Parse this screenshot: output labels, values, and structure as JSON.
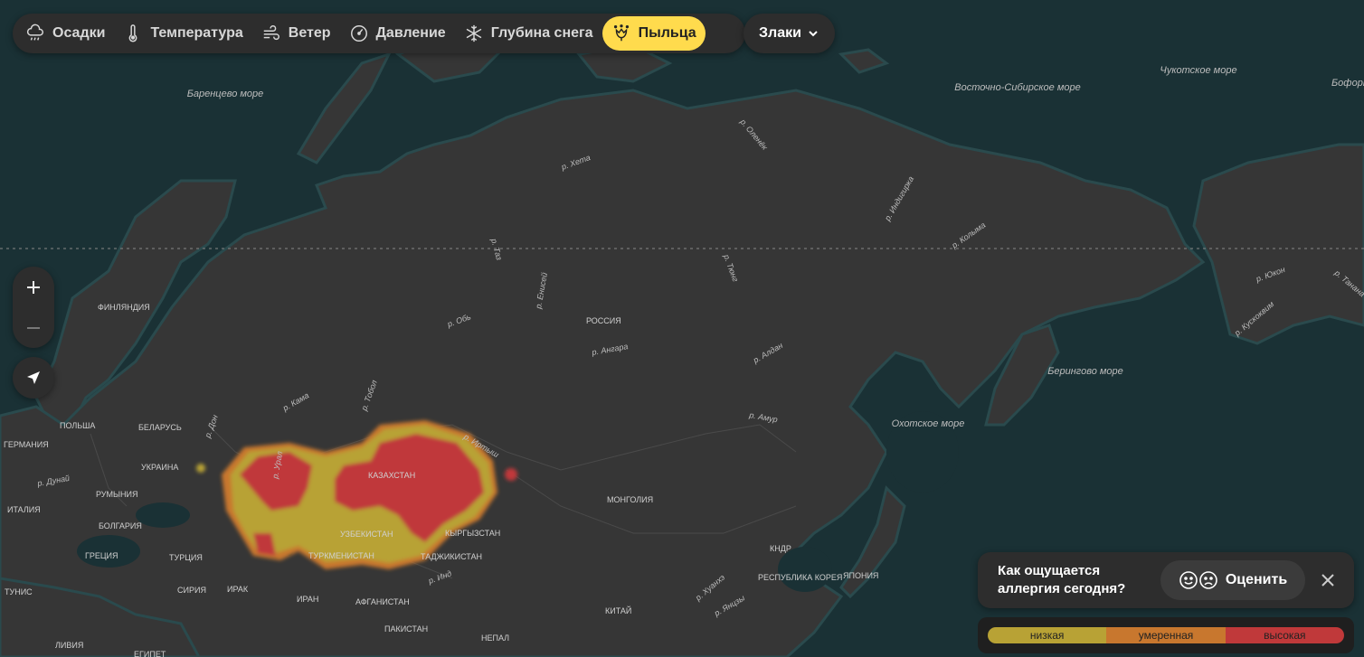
{
  "toolbar": {
    "items": [
      {
        "label": "Осадки",
        "icon": "cloud-rain-icon"
      },
      {
        "label": "Температура",
        "icon": "thermometer-icon"
      },
      {
        "label": "Ветер",
        "icon": "wind-icon"
      },
      {
        "label": "Давление",
        "icon": "gauge-icon"
      },
      {
        "label": "Глубина снега",
        "icon": "snowflake-icon"
      },
      {
        "label": "Пыльца",
        "icon": "pollen-flower-icon",
        "active": true
      }
    ],
    "accent": "#ffdb4d"
  },
  "dropdown": {
    "label": "Злаки",
    "icon": "chevron-down-icon"
  },
  "map_labels": {
    "seas": [
      "Баренцево море",
      "Восточно-Сибирское море",
      "Чукотское море",
      "Берингово море",
      "Охотское море",
      "Бофорта"
    ],
    "countries": [
      "ФИНЛЯНДИЯ",
      "РОССИЯ",
      "ПОЛЬША",
      "БЕЛАРУСЬ",
      "ГЕРМАНИЯ",
      "УКРАИНА",
      "РУМЫНИЯ",
      "ИТАЛИЯ",
      "БОЛГАРИЯ",
      "ГРЕЦИЯ",
      "ТУРЦИЯ",
      "ТУНИС",
      "СИРИЯ",
      "ИРАК",
      "ИРАН",
      "КАЗАХСТАН",
      "УЗБЕКИСТАН",
      "ТУРКМЕНИСТАН",
      "КЫРГЫЗСТАН",
      "ТАДЖИКИСТАН",
      "АФГАНИСТАН",
      "ПАКИСТАН",
      "МОНГОЛИЯ",
      "КИТАЙ",
      "НЕПАЛ",
      "КНДР",
      "РЕСПУБЛИКА КОРЕЯ",
      "ЯПОНИЯ",
      "ЛИВИЯ",
      "ЕГИПЕТ"
    ],
    "rivers": [
      "р. Хета",
      "р. Оленёк",
      "р. Индигирка",
      "р. Колыма",
      "р. Таз",
      "р. Енисей",
      "р. Обь",
      "р. Тюнг",
      "р. Ангара",
      "р. Алдан",
      "р. Кама",
      "р. Тобол",
      "р. Дон",
      "р. Урал",
      "р. Иртыш",
      "р. Амур",
      "р. Дунай",
      "р. Инд",
      "р. Хуанхэ",
      "р. Янцзы",
      "р. Юкон",
      "р. Кускоквим",
      "р. Танана"
    ]
  },
  "zoom": {
    "in_icon": "plus-icon",
    "out_icon": "minus-icon"
  },
  "locate_icon": "location-arrow-icon",
  "survey": {
    "question": "Как ощущается аллергия сегодня?",
    "button_label": "Оценить",
    "close_icon": "close-icon"
  },
  "legend": {
    "items": [
      {
        "label": "низкая",
        "color": "#b8a235"
      },
      {
        "label": "умеренная",
        "color": "#c8772e"
      },
      {
        "label": "высокая",
        "color": "#c0393a"
      }
    ]
  }
}
